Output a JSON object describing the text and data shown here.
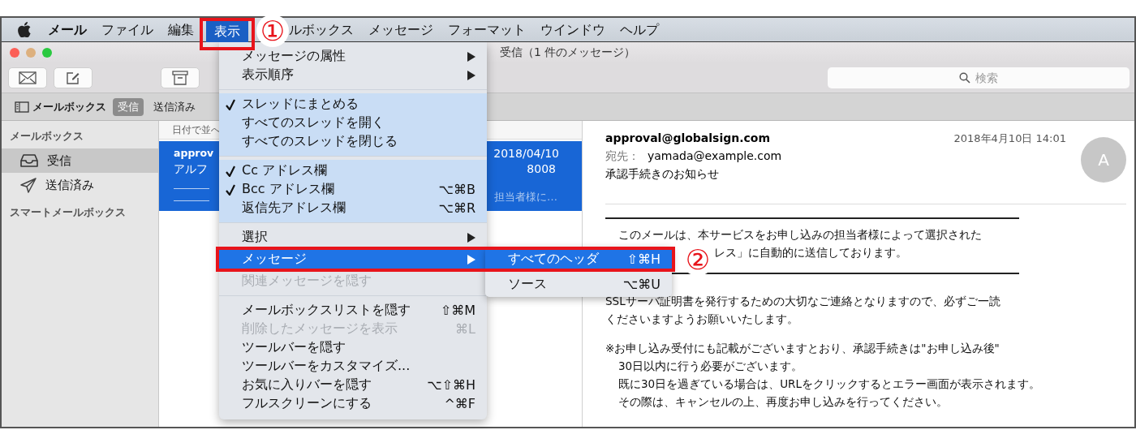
{
  "menubar": {
    "items": [
      {
        "label": "メール",
        "kind": "app",
        "selected": false
      },
      {
        "label": "ファイル",
        "kind": "menu",
        "selected": false
      },
      {
        "label": "編集",
        "kind": "menu",
        "selected": false
      },
      {
        "label": "表示",
        "kind": "menu",
        "selected": true
      },
      {
        "label": "ルボックス",
        "kind": "partial",
        "selected": false
      },
      {
        "label": "メッセージ",
        "kind": "menu",
        "selected": false
      },
      {
        "label": "フォーマット",
        "kind": "menu",
        "selected": false
      },
      {
        "label": "ウインドウ",
        "kind": "menu",
        "selected": false
      },
      {
        "label": "ヘルプ",
        "kind": "menu",
        "selected": false
      }
    ]
  },
  "window": {
    "title": "受信（1 件のメッセージ）"
  },
  "search": {
    "placeholder": "検索"
  },
  "favorites_bar": {
    "mailboxes_button": "メールボックス",
    "items": [
      {
        "label": "受信",
        "selected": true
      },
      {
        "label": "送信済み",
        "selected": false
      }
    ]
  },
  "sidebar": {
    "sections": [
      {
        "heading": "メールボックス",
        "items": [
          {
            "label": "受信",
            "selected": true
          },
          {
            "label": "送信済み",
            "selected": false
          }
        ]
      },
      {
        "heading": "スマートメールボックス"
      }
    ]
  },
  "message_list": {
    "sort_label": "日付で並へ",
    "rows": [
      {
        "sender": "approv",
        "date": "2018/04/10",
        "subject": "アルフ",
        "subject_tail": "8008",
        "preview": "担当者様に…",
        "selected": true
      }
    ]
  },
  "message": {
    "from": "approval@globalsign.com",
    "date": "2018年4月10日 14:01",
    "to_label": "宛先：",
    "to": "yamada@example.com",
    "subject": "承認手続きのお知らせ",
    "avatar": "A",
    "body": [
      {
        "kind": "boxed",
        "lines": [
          {
            "text": "このメールは、本サービスをお申し込みの担当者様によって選択された",
            "kind": "line"
          },
          {
            "text": "レス」に自動的に送信しております。",
            "kind": "tail"
          }
        ]
      },
      {
        "kind": "paragraph",
        "lines": [
          {
            "text": "SSLサーバ証明書を発行するための大切なご連絡となりますので、必ずご一読",
            "kind": "line"
          },
          {
            "text": "くださいますようお願いいたします。",
            "kind": "line"
          }
        ]
      },
      {
        "kind": "note",
        "lines": [
          {
            "text": "※お申し込み受付にも記載がございますとおり、承認手続きは\"お申し込み後\"",
            "kind": "line"
          },
          {
            "text": "30日以内に行う必要がございます。",
            "kind": "indent"
          },
          {
            "text": "既に30日を過ぎている場合は、URLをクリックするとエラー画面が表示されます。",
            "kind": "indent"
          },
          {
            "text": "その際は、キャンセルの上、再度お申し込みを行ってください。",
            "kind": "indent"
          }
        ]
      }
    ]
  },
  "view_menu": {
    "sections": [
      {
        "items": [
          {
            "label": "メッセージの属性",
            "submenu": true,
            "checked": false,
            "disabled": false,
            "selected": false
          },
          {
            "label": "表示順序",
            "submenu": true,
            "checked": false,
            "disabled": false,
            "selected": false
          }
        ]
      },
      {
        "items": [
          {
            "label": "スレッドにまとめる",
            "submenu": false,
            "checked": true,
            "disabled": false,
            "selected": false
          },
          {
            "label": "すべてのスレッドを開く",
            "submenu": false,
            "checked": false,
            "disabled": false,
            "selected": false
          },
          {
            "label": "すべてのスレッドを閉じる",
            "submenu": false,
            "checked": false,
            "disabled": false,
            "selected": false
          }
        ]
      },
      {
        "items": [
          {
            "label": "Cc アドレス欄",
            "submenu": false,
            "checked": true,
            "disabled": false,
            "selected": false
          },
          {
            "label": "Bcc アドレス欄",
            "shortcut": "⌥⌘B",
            "submenu": false,
            "checked": true,
            "disabled": false,
            "selected": false
          },
          {
            "label": "返信先アドレス欄",
            "shortcut": "⌥⌘R",
            "submenu": false,
            "checked": false,
            "disabled": false,
            "selected": false
          }
        ]
      },
      {
        "items": [
          {
            "label": "選択",
            "submenu": true,
            "checked": false,
            "disabled": false,
            "selected": false
          },
          {
            "label": "メッセージ",
            "submenu": true,
            "checked": false,
            "disabled": false,
            "selected": true
          },
          {
            "label": "関連メッセージを隠す",
            "submenu": false,
            "checked": false,
            "disabled": true,
            "selected": false
          }
        ]
      },
      {
        "items": [
          {
            "label": "メールボックスリストを隠す",
            "shortcut": "⇧⌘M",
            "submenu": false,
            "checked": false,
            "disabled": false,
            "selected": false
          },
          {
            "label": "削除したメッセージを表示",
            "shortcut": "⌘L",
            "submenu": false,
            "checked": false,
            "disabled": true,
            "selected": false
          },
          {
            "label": "ツールバーを隠す",
            "submenu": false,
            "checked": false,
            "disabled": false,
            "selected": false
          },
          {
            "label": "ツールバーをカスタマイズ...",
            "submenu": false,
            "checked": false,
            "disabled": false,
            "selected": false
          },
          {
            "label": "お気に入りバーを隠す",
            "shortcut": "⌥⇧⌘H",
            "submenu": false,
            "checked": false,
            "disabled": false,
            "selected": false
          },
          {
            "label": "フルスクリーンにする",
            "shortcut": "^⌘F",
            "submenu": false,
            "checked": false,
            "disabled": false,
            "selected": false
          }
        ]
      }
    ]
  },
  "submenu": {
    "items": [
      {
        "label": "すべてのヘッダ",
        "shortcut": "⇧⌘H",
        "selected": true
      },
      {
        "label": "ソース",
        "shortcut": "⌥⌘U",
        "selected": false
      }
    ]
  },
  "annotations": [
    {
      "label": "①"
    },
    {
      "label": "②"
    }
  ]
}
